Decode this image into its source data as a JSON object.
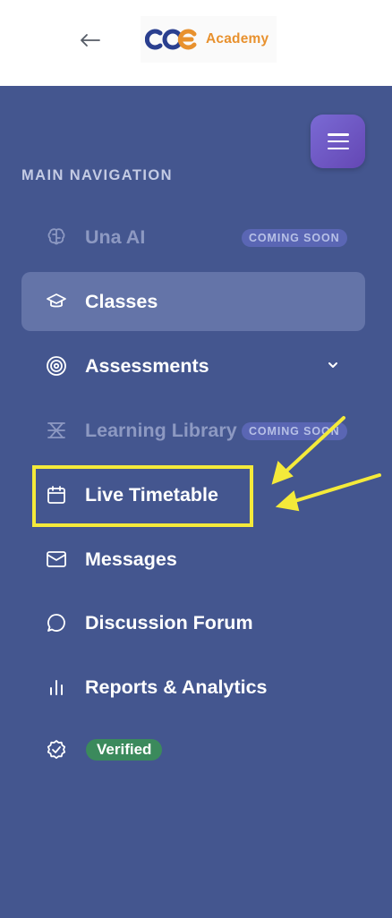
{
  "header": {
    "back_icon": "arrow-left-icon",
    "logo_text": "Academy",
    "logo_colors": {
      "mark": "#2a3f8f",
      "accent": "#e8912e"
    }
  },
  "sidebar": {
    "menu_icon": "hamburger-icon",
    "section_title": "MAIN NAVIGATION",
    "items": [
      {
        "label": "Una AI",
        "icon": "brain-icon",
        "badge": "COMING SOON",
        "disabled": true
      },
      {
        "label": "Classes",
        "icon": "graduation-cap-icon",
        "active": true
      },
      {
        "label": "Assessments",
        "icon": "target-icon",
        "expandable": true
      },
      {
        "label": "Learning Library",
        "icon": "library-icon",
        "badge": "COMING SOON",
        "disabled": true
      },
      {
        "label": "Live Timetable",
        "icon": "calendar-icon",
        "highlighted": true
      },
      {
        "label": "Messages",
        "icon": "mail-icon"
      },
      {
        "label": "Discussion Forum",
        "icon": "chat-bubble-icon"
      },
      {
        "label": "Reports & Analytics",
        "icon": "bar-chart-icon"
      },
      {
        "label": "",
        "icon": "verified-badge-icon",
        "badge": "Verified"
      }
    ]
  },
  "colors": {
    "sidebar_bg": "#44568f",
    "active_bg": "#6474a8",
    "annotation": "#f4ea3a",
    "verified": "#3b8a5c"
  }
}
